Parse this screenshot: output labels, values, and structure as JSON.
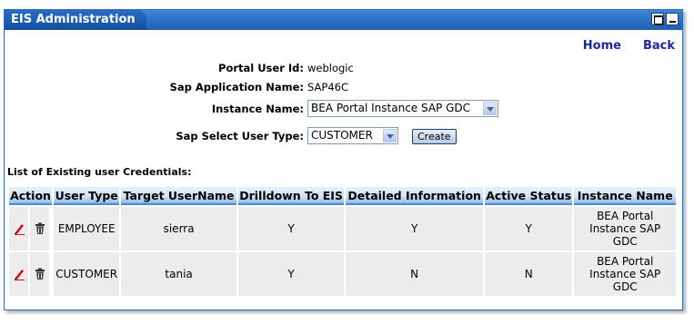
{
  "window": {
    "title": "EIS Administration"
  },
  "nav": {
    "home": "Home",
    "back": "Back"
  },
  "form": {
    "portal_user_id_label": "Portal User Id:",
    "portal_user_id_value": "weblogic",
    "sap_app_name_label": "Sap Application Name:",
    "sap_app_name_value": "SAP46C",
    "instance_name_label": "Instance Name:",
    "instance_name_selected": "BEA Portal Instance SAP GDC",
    "user_type_label": "Sap Select User Type:",
    "user_type_selected": "CUSTOMER",
    "create_button": "Create"
  },
  "list": {
    "caption": "List of Existing user Credentials:",
    "columns": [
      "Action",
      "User Type",
      "Target UserName",
      "Drilldown To EIS",
      "Detailed Information",
      "Active Status",
      "Instance Name"
    ],
    "rows": [
      {
        "user_type": "EMPLOYEE",
        "target_username": "sierra",
        "drilldown": "Y",
        "detailed_info": "Y",
        "active_status": "Y",
        "instance_name": "BEA Portal Instance SAP GDC"
      },
      {
        "user_type": "CUSTOMER",
        "target_username": "tania",
        "drilldown": "Y",
        "detailed_info": "N",
        "active_status": "N",
        "instance_name": "BEA Portal Instance SAP GDC"
      }
    ]
  },
  "icons": {
    "edit": "pencil-icon",
    "delete": "trash-icon",
    "maximize": "maximize-icon",
    "minimize": "minimize-icon"
  },
  "colors": {
    "titlebar": "#1c5fb3",
    "link": "#1c2aa0",
    "header_cell": "#cfe2f6",
    "row_cell": "#ececec"
  }
}
